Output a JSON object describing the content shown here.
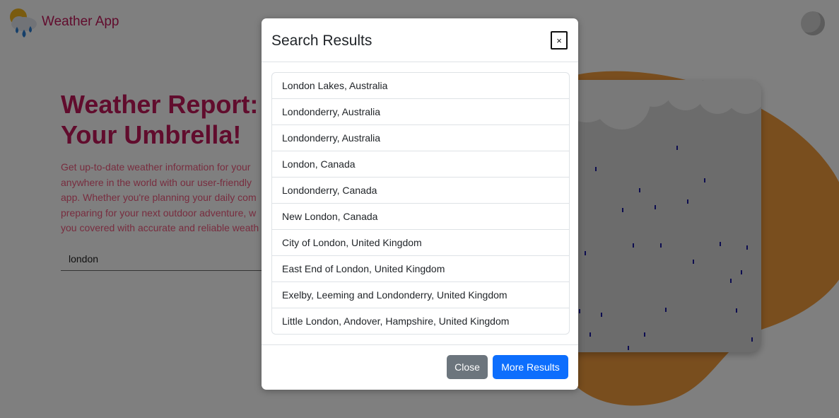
{
  "header": {
    "app_title": "Weather App",
    "logo_icon": "weather-cloud-rain-icon",
    "theme_icon": "moon-icon"
  },
  "hero": {
    "title_lines": [
      "Weather Report: N",
      "Your Umbrella!"
    ],
    "description_lines": [
      "Get up-to-date weather information for your",
      "anywhere in the world with our user-friendly",
      "app. Whether you're planning your daily com",
      "preparing for your next outdoor adventure, w",
      "you covered with accurate and reliable weath"
    ],
    "search_value": "london"
  },
  "modal": {
    "title": "Search Results",
    "close_icon_label": "×",
    "results": [
      "London Lakes, Australia",
      "Londonderry, Australia",
      "Londonderry, Australia",
      "London, Canada",
      "Londonderry, Canada",
      "New London, Canada",
      "City of London, United Kingdom",
      "East End of London, United Kingdom",
      "Exelby, Leeming and Londonderry, United Kingdom",
      "Little London, Andover, Hampshire, United Kingdom"
    ],
    "close_button": "Close",
    "more_button": "More Results"
  },
  "colors": {
    "brand": "#c2185b",
    "accent_text": "#f05a7e",
    "blob": "#f39c3d",
    "primary_button": "#0d6efd",
    "secondary_button": "#6c757d"
  }
}
